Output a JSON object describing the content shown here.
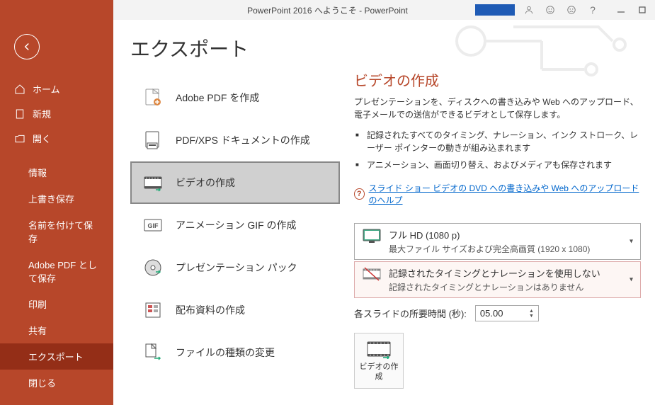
{
  "titlebar": {
    "title": "PowerPoint 2016 へようこそ  -  PowerPoint"
  },
  "sidebar": {
    "home": "ホーム",
    "new": "新規",
    "open": "開く",
    "info": "情報",
    "save": "上書き保存",
    "saveas": "名前を付けて保存",
    "adobepdf": "Adobe PDF として保存",
    "print": "印刷",
    "share": "共有",
    "export": "エクスポート",
    "close": "閉じる"
  },
  "page": {
    "title": "エクスポート"
  },
  "export_items": {
    "adobepdf": "Adobe PDF を作成",
    "pdfxps": "PDF/XPS ドキュメントの作成",
    "video": "ビデオの作成",
    "gif": "アニメーション GIF の作成",
    "package": "プレゼンテーション パック",
    "handout": "配布資料の作成",
    "changetype": "ファイルの種類の変更"
  },
  "detail": {
    "title": "ビデオの作成",
    "desc": "プレゼンテーションを、ディスクへの書き込みや Web へのアップロード、電子メールでの送信ができるビデオとして保存します。",
    "bullet1": "記録されたすべてのタイミング、ナレーション、インク ストローク、レーザー ポインターの動きが組み込まれます",
    "bullet2": "アニメーション、画面切り替え、およびメディアも保存されます",
    "help_link": "スライド ショー ビデオの DVD への書き込みや Web へのアップロードのヘルプ",
    "quality_line1": "フル HD (1080 p)",
    "quality_line2": "最大ファイル サイズおよび完全高画質 (1920 x 1080)",
    "narration_line1": "記録されたタイミングとナレーションを使用しない",
    "narration_line2": "記録されたタイミングとナレーションはありません",
    "time_label": "各スライドの所要時間 (秒):",
    "time_value": "05.00",
    "create_btn": "ビデオの作成"
  }
}
